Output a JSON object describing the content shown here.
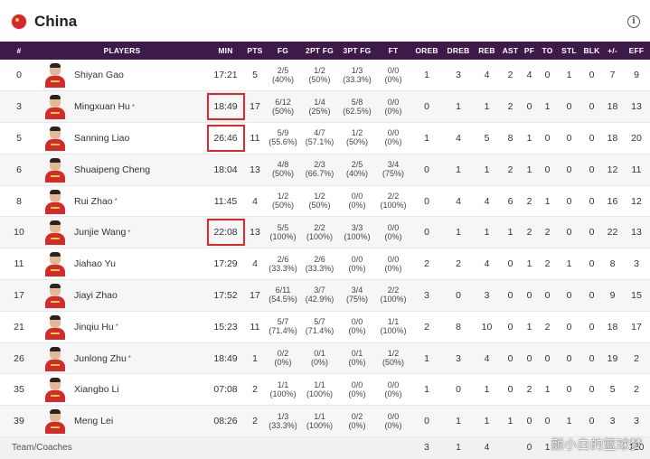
{
  "team": {
    "name": "China",
    "flag_icon": "china-flag-icon",
    "info_icon": "info-icon"
  },
  "columns": [
    "#",
    "PLAYERS",
    "MIN",
    "PTS",
    "FG",
    "2PT FG",
    "3PT FG",
    "FT",
    "OREB",
    "DREB",
    "REB",
    "AST",
    "PF",
    "TO",
    "STL",
    "BLK",
    "+/-",
    "EFF"
  ],
  "players": [
    {
      "num": "0",
      "name": "Shiyan Gao",
      "star": "",
      "min": "17:21",
      "pts": "5",
      "fg": "2/5",
      "fgp": "(40%)",
      "fg2": "1/2",
      "fg2p": "(50%)",
      "fg3": "1/3",
      "fg3p": "(33.3%)",
      "ft": "0/0",
      "ftp": "(0%)",
      "oreb": "1",
      "dreb": "3",
      "reb": "4",
      "ast": "2",
      "pf": "4",
      "to": "0",
      "stl": "1",
      "blk": "0",
      "pm": "7",
      "eff": "9"
    },
    {
      "num": "3",
      "name": "Mingxuan Hu",
      "star": "*",
      "min": "18:49",
      "pts": "17",
      "fg": "6/12",
      "fgp": "(50%)",
      "fg2": "1/4",
      "fg2p": "(25%)",
      "fg3": "5/8",
      "fg3p": "(62.5%)",
      "ft": "0/0",
      "ftp": "(0%)",
      "oreb": "0",
      "dreb": "1",
      "reb": "1",
      "ast": "2",
      "pf": "0",
      "to": "1",
      "stl": "0",
      "blk": "0",
      "pm": "18",
      "eff": "13"
    },
    {
      "num": "5",
      "name": "Sanning Liao",
      "star": "",
      "min": "26:46",
      "pts": "11",
      "fg": "5/9",
      "fgp": "(55.6%)",
      "fg2": "4/7",
      "fg2p": "(57.1%)",
      "fg3": "1/2",
      "fg3p": "(50%)",
      "ft": "0/0",
      "ftp": "(0%)",
      "oreb": "1",
      "dreb": "4",
      "reb": "5",
      "ast": "8",
      "pf": "1",
      "to": "0",
      "stl": "0",
      "blk": "0",
      "pm": "18",
      "eff": "20"
    },
    {
      "num": "6",
      "name": "Shuaipeng Cheng",
      "star": "",
      "min": "18:04",
      "pts": "13",
      "fg": "4/8",
      "fgp": "(50%)",
      "fg2": "2/3",
      "fg2p": "(66.7%)",
      "fg3": "2/5",
      "fg3p": "(40%)",
      "ft": "3/4",
      "ftp": "(75%)",
      "oreb": "0",
      "dreb": "1",
      "reb": "1",
      "ast": "2",
      "pf": "1",
      "to": "0",
      "stl": "0",
      "blk": "0",
      "pm": "12",
      "eff": "11"
    },
    {
      "num": "8",
      "name": "Rui Zhao",
      "star": "*",
      "min": "11:45",
      "pts": "4",
      "fg": "1/2",
      "fgp": "(50%)",
      "fg2": "1/2",
      "fg2p": "(50%)",
      "fg3": "0/0",
      "fg3p": "(0%)",
      "ft": "2/2",
      "ftp": "(100%)",
      "oreb": "0",
      "dreb": "4",
      "reb": "4",
      "ast": "6",
      "pf": "2",
      "to": "1",
      "stl": "0",
      "blk": "0",
      "pm": "16",
      "eff": "12"
    },
    {
      "num": "10",
      "name": "Junjie Wang",
      "star": "*",
      "min": "22:08",
      "pts": "13",
      "fg": "5/5",
      "fgp": "(100%)",
      "fg2": "2/2",
      "fg2p": "(100%)",
      "fg3": "3/3",
      "fg3p": "(100%)",
      "ft": "0/0",
      "ftp": "(0%)",
      "oreb": "0",
      "dreb": "1",
      "reb": "1",
      "ast": "1",
      "pf": "2",
      "to": "2",
      "stl": "0",
      "blk": "0",
      "pm": "22",
      "eff": "13"
    },
    {
      "num": "11",
      "name": "Jiahao Yu",
      "star": "",
      "min": "17:29",
      "pts": "4",
      "fg": "2/6",
      "fgp": "(33.3%)",
      "fg2": "2/6",
      "fg2p": "(33.3%)",
      "fg3": "0/0",
      "fg3p": "(0%)",
      "ft": "0/0",
      "ftp": "(0%)",
      "oreb": "2",
      "dreb": "2",
      "reb": "4",
      "ast": "0",
      "pf": "1",
      "to": "2",
      "stl": "1",
      "blk": "0",
      "pm": "8",
      "eff": "3"
    },
    {
      "num": "17",
      "name": "Jiayi Zhao",
      "star": "",
      "min": "17:52",
      "pts": "17",
      "fg": "6/11",
      "fgp": "(54.5%)",
      "fg2": "3/7",
      "fg2p": "(42.9%)",
      "fg3": "3/4",
      "fg3p": "(75%)",
      "ft": "2/2",
      "ftp": "(100%)",
      "oreb": "3",
      "dreb": "0",
      "reb": "3",
      "ast": "0",
      "pf": "0",
      "to": "0",
      "stl": "0",
      "blk": "0",
      "pm": "9",
      "eff": "15"
    },
    {
      "num": "21",
      "name": "Jinqiu Hu",
      "star": "*",
      "min": "15:23",
      "pts": "11",
      "fg": "5/7",
      "fgp": "(71.4%)",
      "fg2": "5/7",
      "fg2p": "(71.4%)",
      "fg3": "0/0",
      "fg3p": "(0%)",
      "ft": "1/1",
      "ftp": "(100%)",
      "oreb": "2",
      "dreb": "8",
      "reb": "10",
      "ast": "0",
      "pf": "1",
      "to": "2",
      "stl": "0",
      "blk": "0",
      "pm": "18",
      "eff": "17"
    },
    {
      "num": "26",
      "name": "Junlong Zhu",
      "star": "*",
      "min": "18:49",
      "pts": "1",
      "fg": "0/2",
      "fgp": "(0%)",
      "fg2": "0/1",
      "fg2p": "(0%)",
      "fg3": "0/1",
      "fg3p": "(0%)",
      "ft": "1/2",
      "ftp": "(50%)",
      "oreb": "1",
      "dreb": "3",
      "reb": "4",
      "ast": "0",
      "pf": "0",
      "to": "0",
      "stl": "0",
      "blk": "0",
      "pm": "19",
      "eff": "2"
    },
    {
      "num": "35",
      "name": "Xiangbo Li",
      "star": "",
      "min": "07:08",
      "pts": "2",
      "fg": "1/1",
      "fgp": "(100%)",
      "fg2": "1/1",
      "fg2p": "(100%)",
      "fg3": "0/0",
      "fg3p": "(0%)",
      "ft": "0/0",
      "ftp": "(0%)",
      "oreb": "1",
      "dreb": "0",
      "reb": "1",
      "ast": "0",
      "pf": "2",
      "to": "1",
      "stl": "0",
      "blk": "0",
      "pm": "5",
      "eff": "2"
    },
    {
      "num": "39",
      "name": "Meng Lei",
      "star": "",
      "min": "08:26",
      "pts": "2",
      "fg": "1/3",
      "fgp": "(33.3%)",
      "fg2": "1/1",
      "fg2p": "(100%)",
      "fg3": "0/2",
      "fg3p": "(0%)",
      "ft": "0/0",
      "ftp": "(0%)",
      "oreb": "0",
      "dreb": "1",
      "reb": "1",
      "ast": "1",
      "pf": "0",
      "to": "0",
      "stl": "1",
      "blk": "0",
      "pm": "3",
      "eff": "3"
    }
  ],
  "highlighted_minutes_rows": [
    1,
    2,
    5
  ],
  "totals": {
    "label": "Team/Coaches",
    "oreb": "3",
    "dreb": "1",
    "reb": "4",
    "pf": "0",
    "to": "1",
    "eff": "120"
  },
  "watermark": "颜小白的篮球梦",
  "colors": {
    "header_bg": "#3d1a4a",
    "highlight": "#e8232a",
    "flag": "#d9262b"
  }
}
